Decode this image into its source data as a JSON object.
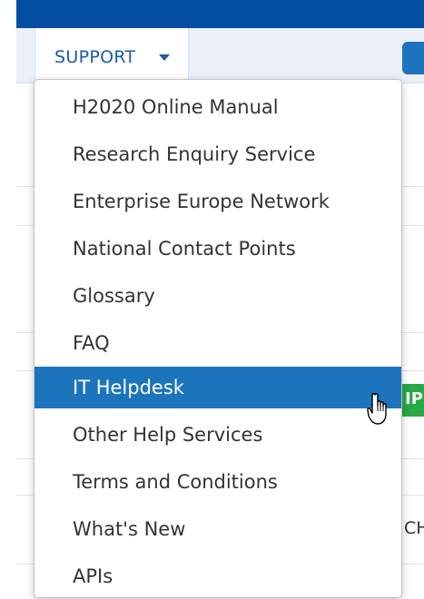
{
  "nav": {
    "support_label": "SUPPORT"
  },
  "dropdown": {
    "items": [
      {
        "label": "H2020 Online Manual"
      },
      {
        "label": "Research Enquiry Service"
      },
      {
        "label": "Enterprise Europe Network"
      },
      {
        "label": "National Contact Points"
      },
      {
        "label": "Glossary"
      },
      {
        "label": "FAQ"
      },
      {
        "label": "IT Helpdesk",
        "active": true
      },
      {
        "label": "Other Help Services"
      },
      {
        "label": "Terms and Conditions"
      },
      {
        "label": "What's New"
      },
      {
        "label": "APIs"
      }
    ]
  },
  "background": {
    "badge_text": "IP",
    "side_text": "CHA"
  },
  "colors": {
    "top_bar": "#034ea2",
    "accent": "#1c75bc",
    "link": "#1a5aa8",
    "badge": "#29a847"
  },
  "icons": {
    "caret": "caret-down-icon",
    "cursor": "hand-pointer-icon"
  }
}
